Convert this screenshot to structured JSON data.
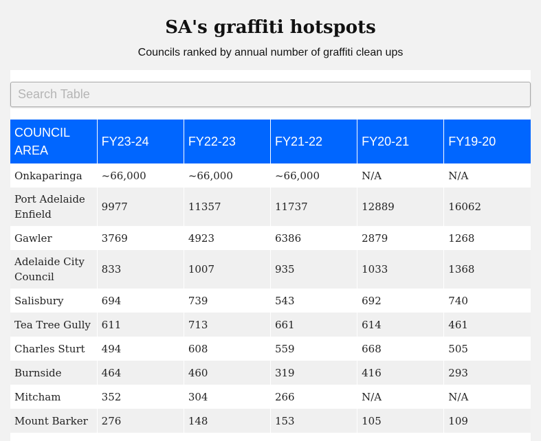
{
  "header": {
    "title": "SA's graffiti hotspots",
    "subtitle": "Councils ranked by annual number of graffiti clean ups"
  },
  "search": {
    "placeholder": "Search Table",
    "value": ""
  },
  "table": {
    "columns": [
      "COUNCIL AREA",
      "FY23-24",
      "FY22-23",
      "FY21-22",
      "FY20-21",
      "FY19-20"
    ],
    "rows": [
      [
        "Onkaparinga",
        "~66,000",
        "~66,000",
        "~66,000",
        "N/A",
        "N/A"
      ],
      [
        "Port Adelaide Enfield",
        "9977",
        "11357",
        "11737",
        "12889",
        "16062"
      ],
      [
        "Gawler",
        "3769",
        "4923",
        "6386",
        "2879",
        "1268"
      ],
      [
        "Adelaide City Council",
        "833",
        "1007",
        "935",
        "1033",
        "1368"
      ],
      [
        "Salisbury",
        "694",
        "739",
        "543",
        "692",
        "740"
      ],
      [
        "Tea Tree Gully",
        "611",
        "713",
        "661",
        "614",
        "461"
      ],
      [
        "Charles Sturt",
        "494",
        "608",
        "559",
        "668",
        "505"
      ],
      [
        "Burnside",
        "464",
        "460",
        "319",
        "416",
        "293"
      ],
      [
        "Mitcham",
        "352",
        "304",
        "266",
        "N/A",
        "N/A"
      ],
      [
        "Mount Barker",
        "276",
        "148",
        "153",
        "105",
        "109"
      ]
    ]
  },
  "colors": {
    "header_bg": "#0066ff",
    "header_text": "#ffffff",
    "row_alt": "#f0f0f0",
    "page_bg": "#f2f2f2"
  }
}
